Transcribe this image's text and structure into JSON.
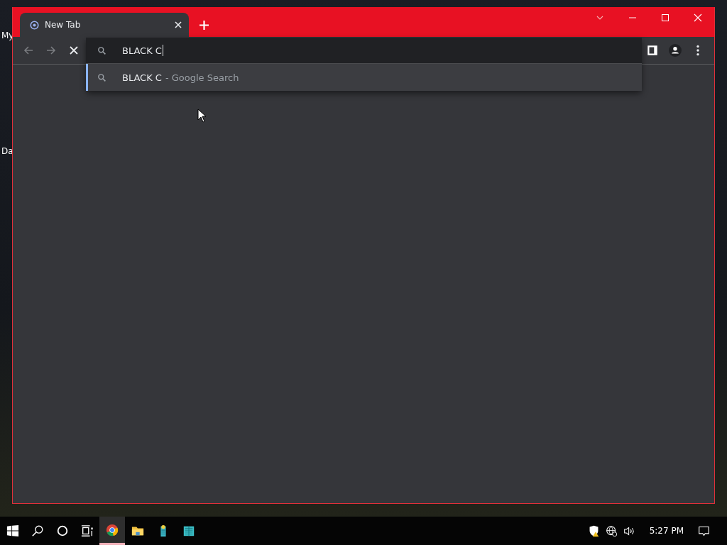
{
  "desktop": {
    "icon_labels": [
      "My",
      "Da"
    ]
  },
  "browser": {
    "tabs": [
      {
        "title": "New Tab",
        "selected": true
      }
    ],
    "loading": true,
    "omnibox": {
      "value": "BLACK C",
      "suggestions": [
        {
          "query": "BLACK C",
          "source": "- Google Search",
          "selected": true
        }
      ]
    }
  },
  "taskbar": {
    "apps": [
      {
        "kind": "browser",
        "active": true
      },
      {
        "kind": "folder",
        "active": false
      },
      {
        "kind": "tool",
        "active": false
      },
      {
        "kind": "grid",
        "active": false
      }
    ],
    "time": "5:27 PM"
  }
}
